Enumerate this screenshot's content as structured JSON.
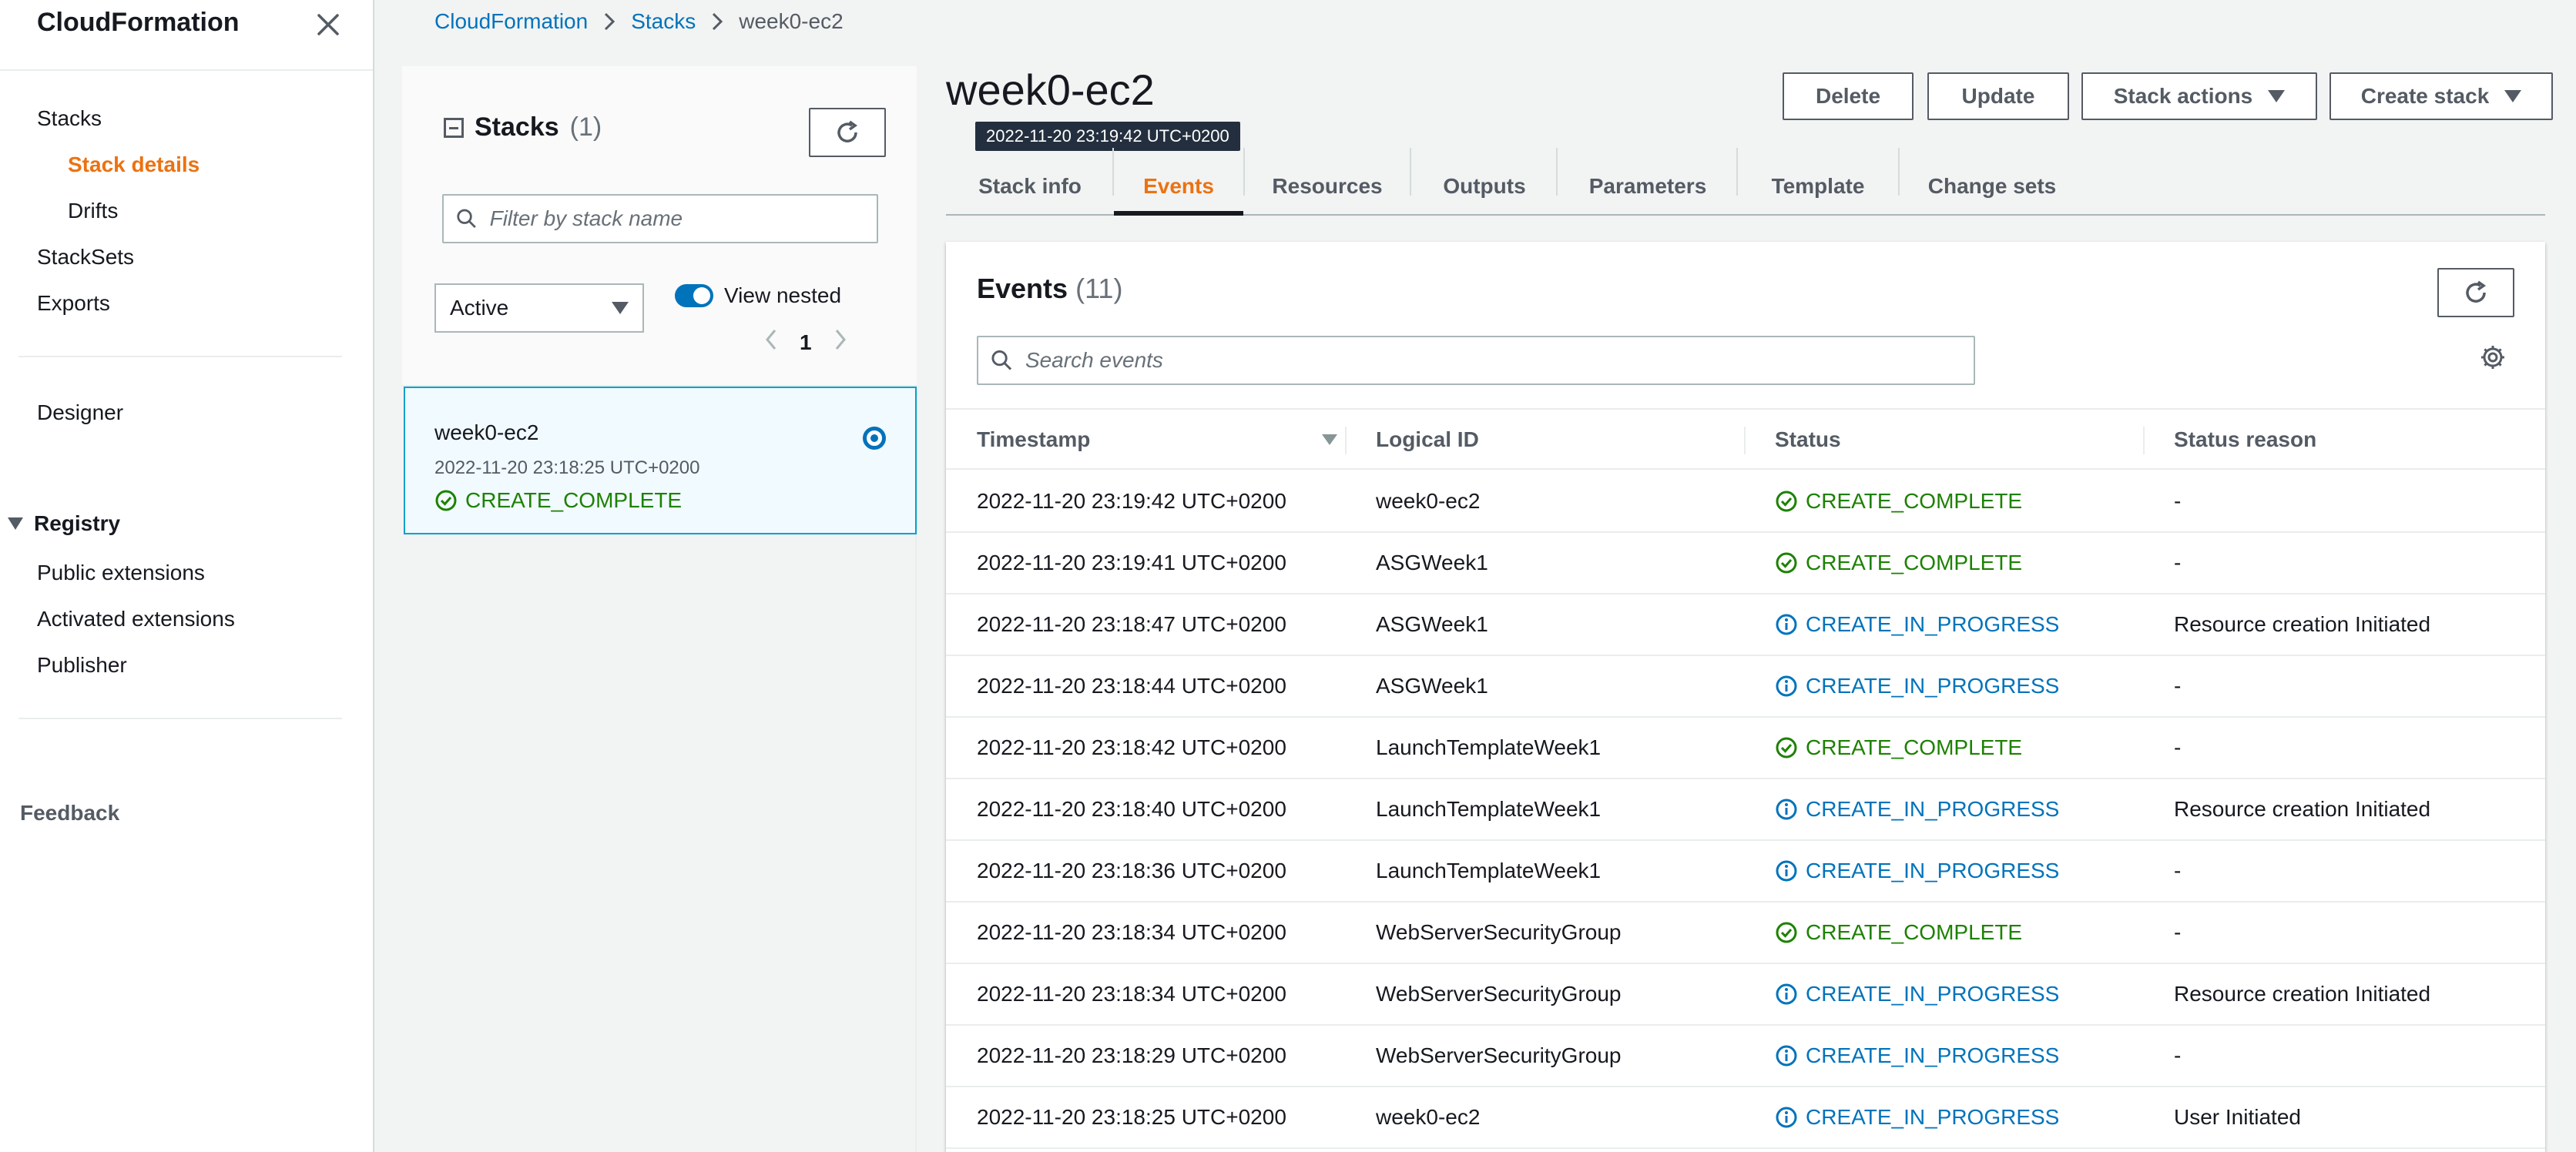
{
  "sidebar": {
    "title": "CloudFormation",
    "items": {
      "stacks": "Stacks",
      "stack_details": "Stack details",
      "drifts": "Drifts",
      "stacksets": "StackSets",
      "exports": "Exports",
      "designer": "Designer"
    },
    "registry": {
      "heading": "Registry",
      "public_extensions": "Public extensions",
      "activated_extensions": "Activated extensions",
      "publisher": "Publisher"
    },
    "feedback": "Feedback"
  },
  "breadcrumb": [
    "CloudFormation",
    "Stacks",
    "week0-ec2"
  ],
  "stacks_panel": {
    "heading": "Stacks",
    "count": "(1)",
    "filter_placeholder": "Filter by stack name",
    "status_filter": "Active",
    "view_nested_label": "View nested",
    "view_nested_on": true,
    "page": "1",
    "stack": {
      "name": "week0-ec2",
      "created": "2022-11-20 23:18:25 UTC+0200",
      "status": "CREATE_COMPLETE"
    }
  },
  "detail": {
    "title": "week0-ec2",
    "tooltip": "2022-11-20 23:19:42 UTC+0200",
    "buttons": {
      "delete": "Delete",
      "update": "Update",
      "stack_actions": "Stack actions",
      "create_stack": "Create stack"
    },
    "tabs": [
      "Stack info",
      "Events",
      "Resources",
      "Outputs",
      "Parameters",
      "Template",
      "Change sets"
    ],
    "active_tab": "Events"
  },
  "events": {
    "heading": "Events",
    "count": "(11)",
    "search_placeholder": "Search events",
    "columns": {
      "timestamp": "Timestamp",
      "logical_id": "Logical ID",
      "status": "Status",
      "status_reason": "Status reason"
    },
    "rows": [
      {
        "timestamp": "2022-11-20 23:19:42 UTC+0200",
        "logical_id": "week0-ec2",
        "status": "CREATE_COMPLETE",
        "reason": "-"
      },
      {
        "timestamp": "2022-11-20 23:19:41 UTC+0200",
        "logical_id": "ASGWeek1",
        "status": "CREATE_COMPLETE",
        "reason": "-"
      },
      {
        "timestamp": "2022-11-20 23:18:47 UTC+0200",
        "logical_id": "ASGWeek1",
        "status": "CREATE_IN_PROGRESS",
        "reason": "Resource creation Initiated"
      },
      {
        "timestamp": "2022-11-20 23:18:44 UTC+0200",
        "logical_id": "ASGWeek1",
        "status": "CREATE_IN_PROGRESS",
        "reason": "-"
      },
      {
        "timestamp": "2022-11-20 23:18:42 UTC+0200",
        "logical_id": "LaunchTemplateWeek1",
        "status": "CREATE_COMPLETE",
        "reason": "-"
      },
      {
        "timestamp": "2022-11-20 23:18:40 UTC+0200",
        "logical_id": "LaunchTemplateWeek1",
        "status": "CREATE_IN_PROGRESS",
        "reason": "Resource creation Initiated"
      },
      {
        "timestamp": "2022-11-20 23:18:36 UTC+0200",
        "logical_id": "LaunchTemplateWeek1",
        "status": "CREATE_IN_PROGRESS",
        "reason": "-"
      },
      {
        "timestamp": "2022-11-20 23:18:34 UTC+0200",
        "logical_id": "WebServerSecurityGroup",
        "status": "CREATE_COMPLETE",
        "reason": "-"
      },
      {
        "timestamp": "2022-11-20 23:18:34 UTC+0200",
        "logical_id": "WebServerSecurityGroup",
        "status": "CREATE_IN_PROGRESS",
        "reason": "Resource creation Initiated"
      },
      {
        "timestamp": "2022-11-20 23:18:29 UTC+0200",
        "logical_id": "WebServerSecurityGroup",
        "status": "CREATE_IN_PROGRESS",
        "reason": "-"
      },
      {
        "timestamp": "2022-11-20 23:18:25 UTC+0200",
        "logical_id": "week0-ec2",
        "status": "CREATE_IN_PROGRESS",
        "reason": "User Initiated"
      }
    ]
  },
  "colors": {
    "accent_orange": "#ec7211",
    "link_blue": "#0073bb",
    "success_green": "#1d8102"
  }
}
